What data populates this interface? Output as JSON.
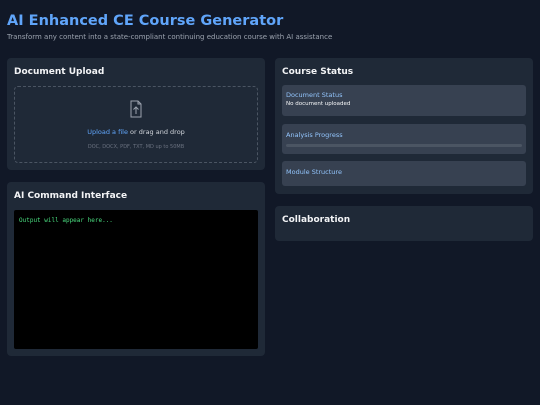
{
  "header": {
    "title": "AI Enhanced CE Course Generator",
    "subtitle": "Transform any content into a state-compliant continuing education course with AI assistance"
  },
  "upload": {
    "title": "Document Upload",
    "link_text": "Upload a file",
    "drop_text": " or drag and drop",
    "hint": "DOC, DOCX, PDF, TXT, MD up to 50MB",
    "icon": "upload-file-icon"
  },
  "ai_command": {
    "title": "AI Command Interface",
    "output_placeholder": "Output will appear here..."
  },
  "course_status": {
    "title": "Course Status",
    "document_status_label": "Document Status",
    "document_status_value": "No document uploaded",
    "analysis_label": "Analysis Progress",
    "analysis_progress": 0,
    "module_label": "Module Structure"
  },
  "collaboration": {
    "title": "Collaboration"
  },
  "colors": {
    "background": "#111827",
    "card": "#1f2937",
    "accent": "#60a5fa",
    "console_text": "#4ade80"
  }
}
